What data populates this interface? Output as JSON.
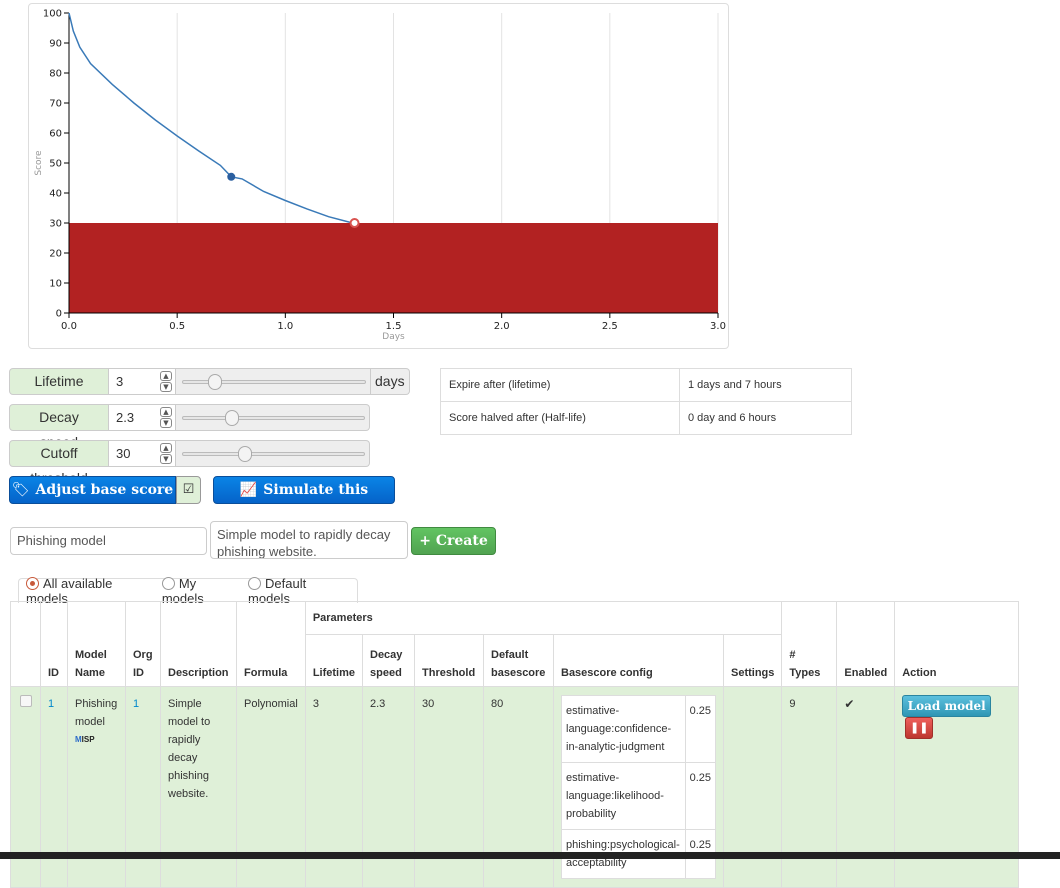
{
  "chart_data": {
    "type": "line",
    "xlabel": "Days",
    "ylabel": "Score",
    "xlim": [
      0,
      3
    ],
    "ylim": [
      0,
      100
    ],
    "x_ticks": [
      "0.0",
      "0.5",
      "1.0",
      "1.5",
      "2.0",
      "2.5",
      "3.0"
    ],
    "y_ticks": [
      "0",
      "10",
      "20",
      "30",
      "40",
      "50",
      "60",
      "70",
      "80",
      "90",
      "100"
    ],
    "series": [
      {
        "x": [
          0,
          0.02,
          0.05,
          0.1,
          0.2,
          0.3,
          0.4,
          0.5,
          0.6,
          0.7,
          0.75,
          0.8,
          0.9,
          1.0,
          1.1,
          1.2,
          1.3,
          1.32
        ],
        "y": [
          100,
          94,
          88.6,
          83.1,
          76.2,
          70.0,
          64.3,
          59.0,
          54.0,
          49.2,
          45.4,
          44.7,
          40.5,
          37.5,
          34.7,
          32.1,
          30.2,
          30
        ]
      }
    ],
    "points": [
      {
        "x": 0.75,
        "y": 45.4,
        "color": "#2b5fa0"
      },
      {
        "x": 1.32,
        "y": 30,
        "color": "#d9534f"
      }
    ],
    "cutoff_region": {
      "y": 30,
      "color": "#b22222"
    },
    "line_color": "#3a7ab8",
    "grid": "vertical"
  },
  "controls": {
    "lifetime": {
      "label": "Lifetime",
      "value": "3",
      "unit": "days",
      "slider": 0.15
    },
    "decay_speed": {
      "label": "Decay speed",
      "value": "2.3",
      "slider": 0.25
    },
    "cutoff": {
      "label": "Cutoff threshold",
      "value": "30",
      "slider": 0.33
    }
  },
  "info": {
    "expire_label": "Expire after (lifetime)",
    "expire_value": "1 days and 7 hours",
    "halved_label": "Score halved after (Half-life)",
    "halved_value": "0 day and 6 hours"
  },
  "buttons": {
    "adjust": "Adjust base score",
    "simulate": "Simulate this model",
    "create": "Create"
  },
  "form": {
    "name_value": "Phishing model",
    "desc_value": "Simple model to rapidly decay phishing website."
  },
  "filters": {
    "all": "All available models",
    "mine": "My models",
    "default": "Default models"
  },
  "table": {
    "headers": {
      "parameters": "Parameters",
      "id": "ID",
      "model_name": "Model Name",
      "org_id": "Org ID",
      "description": "Description",
      "formula": "Formula",
      "lifetime": "Lifetime",
      "decay_speed": "Decay speed",
      "threshold": "Threshold",
      "default_basescore": "Default basescore",
      "basescore_config": "Basescore config",
      "settings": "Settings",
      "types": "# Types",
      "enabled": "Enabled",
      "action": "Action"
    },
    "row": {
      "id": "1",
      "name": "Phishing model",
      "org_id": "1",
      "org_logo": "MISP",
      "description": "Simple model to rapidly decay phishing website.",
      "formula": "Polynomial",
      "lifetime": "3",
      "decay_speed": "2.3",
      "threshold": "30",
      "default_basescore": "80",
      "basescore": [
        {
          "tag": "estimative-language:confidence-in-analytic-judgment",
          "value": "0.25"
        },
        {
          "tag": "estimative-language:likelihood-probability",
          "value": "0.25"
        },
        {
          "tag": "phishing:psychological-acceptability",
          "value": "0.25"
        }
      ],
      "settings": "",
      "types": "9",
      "enabled": "✔",
      "load_label": "Load model"
    }
  }
}
